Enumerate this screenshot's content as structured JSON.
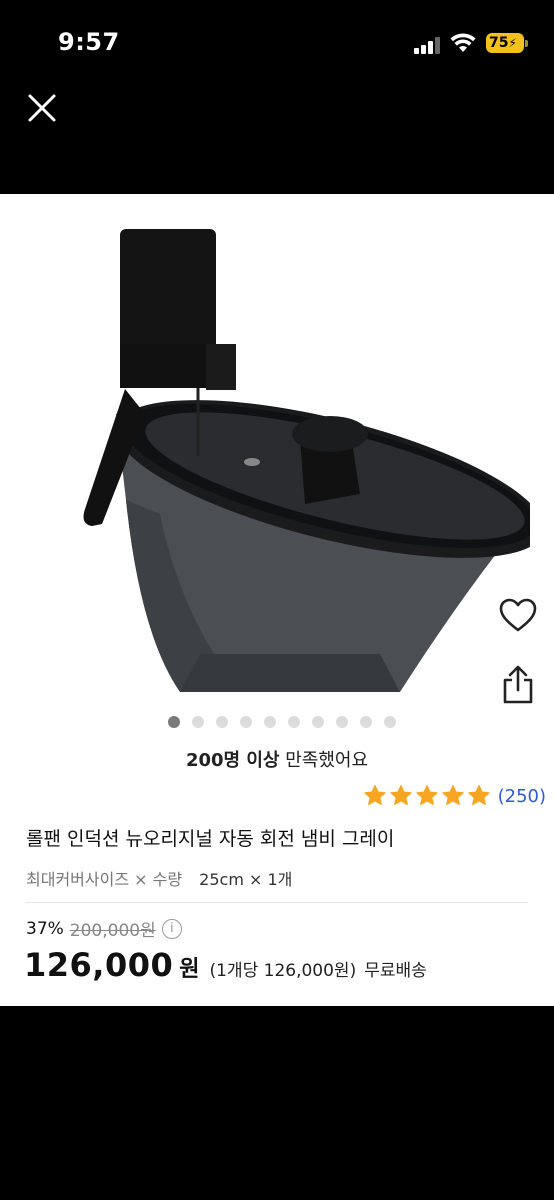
{
  "status_bar": {
    "time": "9:57",
    "battery_level": "75"
  },
  "icons": {
    "close": "close-icon",
    "heart": "heart-icon",
    "share": "share-icon",
    "info": "info-icon",
    "star": "star-icon"
  },
  "carousel": {
    "total": 10,
    "active_index": 0
  },
  "product": {
    "satisfaction_bold": "200명 이상",
    "satisfaction_rest": "만족했어요",
    "rating_stars": 5,
    "rating_count": "(250)",
    "title": "롤팬 인덕션 뉴오리지널 자동 회전 냄비 그레이",
    "option_label": "최대커버사이즈 × 수량",
    "option_value": "25cm × 1개",
    "discount_percent": "37%",
    "original_price": "200,000원",
    "info_symbol": "i",
    "price": "126,000",
    "price_unit": "원",
    "price_per_unit": "(1개당 126,000원)",
    "shipping": "무료배송"
  },
  "colors": {
    "star": "#f6a623",
    "rating_link": "#2f5bd7",
    "battery": "#f2c21b",
    "background_dark": "#000000"
  }
}
